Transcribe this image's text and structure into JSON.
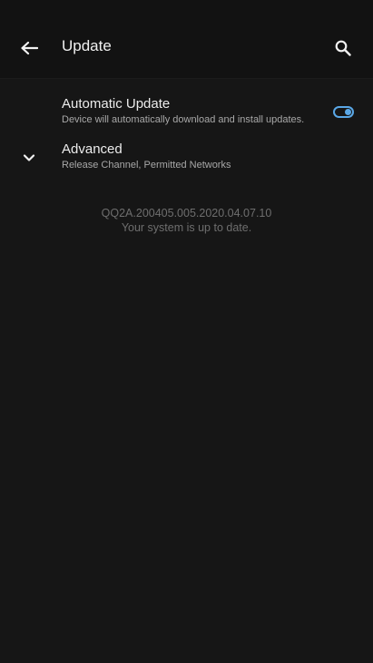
{
  "app_bar": {
    "title": "Update",
    "back_icon": "arrow-left-icon",
    "search_icon": "search-icon"
  },
  "settings": {
    "automatic_update": {
      "title": "Automatic Update",
      "subtitle": "Device will automatically download and install updates.",
      "enabled": true
    },
    "advanced": {
      "title": "Advanced",
      "subtitle": "Release Channel, Permitted Networks",
      "icon": "chevron-down-icon"
    }
  },
  "status": {
    "version": "QQ2A.200405.005.2020.04.07.10",
    "message": "Your system is up to date."
  },
  "colors": {
    "background": "#161616",
    "accent": "#5aa7e6",
    "secondary_text": "#a8a8a8"
  }
}
